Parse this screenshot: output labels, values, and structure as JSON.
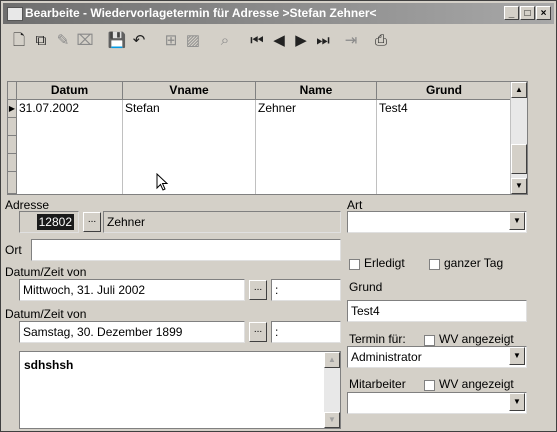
{
  "window": {
    "title": "Bearbeite - Wiedervorlagetermin für Adresse >Stefan Zehner<",
    "controls": [
      "minimize",
      "maximize",
      "close"
    ]
  },
  "toolbar": {
    "icons": [
      "new-icon",
      "copy-icon",
      "edit-icon",
      "delete-icon",
      "save-icon",
      "undo-icon",
      "insert-icon",
      "edit-record-icon",
      "find-icon",
      "first-record-icon",
      "previous-record-icon",
      "next-record-icon",
      "last-record-icon",
      "exit-icon",
      "print-icon"
    ]
  },
  "grid": {
    "columns": [
      "Datum",
      "Vname",
      "Name",
      "Grund"
    ],
    "rows": [
      {
        "datum": "31.07.2002",
        "vname": "Stefan",
        "name": "Zehner",
        "grund": "Test4"
      }
    ]
  },
  "form": {
    "adresse_label": "Adresse",
    "adresse_id": "12802",
    "adresse_name": "Zehner",
    "ort_label": "Ort",
    "ort_value": "",
    "datum_von_label": "Datum/Zeit von",
    "datum_von_value": "Mittwoch, 31. Juli 2002",
    "zeit_von_value": ":",
    "datum_bis_label": "Datum/Zeit von",
    "datum_bis_value": "Samstag, 30. Dezember 1899",
    "zeit_bis_value": ":",
    "memo_text": "sdhshsh",
    "art_label": "Art",
    "art_value": "",
    "erledigt_label": "Erledigt",
    "ganzer_tag_label": "ganzer Tag",
    "grund_label": "Grund",
    "grund_value": "Test4",
    "termin_fuer_label": "Termin für:",
    "wv_angezeigt_label": "WV angezeigt",
    "termin_fuer_value": "Administrator",
    "mitarbeiter_label": "Mitarbeiter",
    "wv_angezeigt2_label": "WV angezeigt",
    "mitarbeiter_value": ""
  },
  "glyphs": {
    "ellipsis": "...",
    "dropdown": "▼",
    "scroll_up": "▲",
    "scroll_down": "▼",
    "row_pointer": "▶"
  }
}
